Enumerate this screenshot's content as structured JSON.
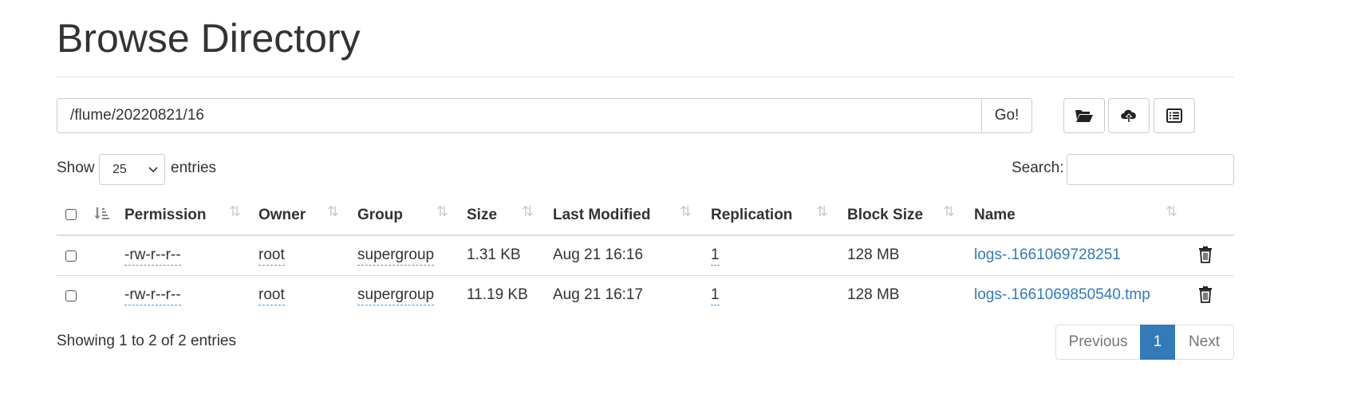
{
  "page": {
    "title": "Browse Directory"
  },
  "pathbar": {
    "path": "/flume/20220821/16",
    "go_label": "Go!"
  },
  "tools": {
    "create_dir_icon": "folder-open-icon",
    "upload_icon": "cloud-upload-icon",
    "cut_paste_icon": "list-alt-icon"
  },
  "length": {
    "show_label": "Show",
    "value": "25",
    "entries_label": "entries"
  },
  "search": {
    "label": "Search:",
    "value": ""
  },
  "table": {
    "columns": [
      "Permission",
      "Owner",
      "Group",
      "Size",
      "Last Modified",
      "Replication",
      "Block Size",
      "Name"
    ],
    "rows": [
      {
        "permission": "-rw-r--r--",
        "owner": "root",
        "group": "supergroup",
        "size": "1.31 KB",
        "modified": "Aug 21 16:16",
        "replication": "1",
        "block_size": "128 MB",
        "name": "logs-.1661069728251"
      },
      {
        "permission": "-rw-r--r--",
        "owner": "root",
        "group": "supergroup",
        "size": "11.19 KB",
        "modified": "Aug 21 16:17",
        "replication": "1",
        "block_size": "128 MB",
        "name": "logs-.1661069850540.tmp"
      }
    ]
  },
  "footer": {
    "info": "Showing 1 to 2 of 2 entries",
    "pager": {
      "previous": "Previous",
      "current": "1",
      "next": "Next"
    }
  },
  "colors": {
    "link": "#337ab7",
    "active_page": "#337ab7",
    "underline": "#4a9bd6"
  }
}
